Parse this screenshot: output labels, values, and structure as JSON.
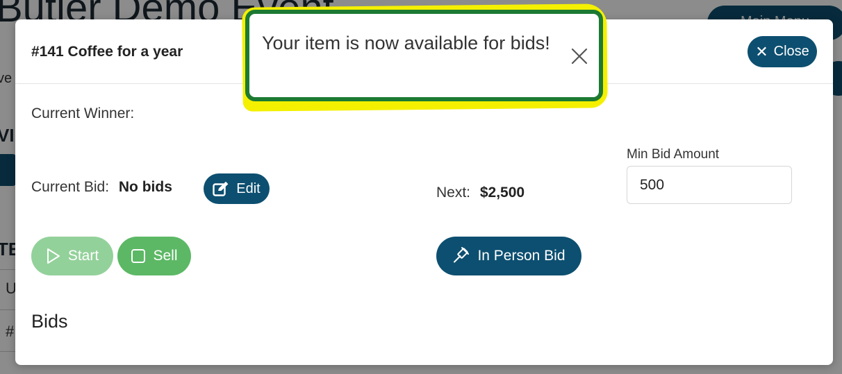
{
  "background": {
    "title": "Butler Demo Event",
    "menu_label": "Main Menu",
    "ev_fragment": "ve",
    "vid_fragment": "VID",
    "te_fragment": "TE",
    "u_fragment": "U",
    "hash_fragment": "#"
  },
  "modal": {
    "title": "#141 Coffee for a year",
    "close_label": "Close",
    "current_winner_label": "Current Winner:",
    "current_bid_label": "Current Bid:",
    "current_bid_value": "No bids",
    "edit_label": "Edit",
    "next_label": "Next:",
    "next_value": "$2,500",
    "min_bid_label": "Min Bid Amount",
    "min_bid_value": "500",
    "start_label": "Start",
    "sell_label": "Sell",
    "in_person_bid_label": "In Person Bid",
    "bids_heading": "Bids"
  },
  "toast": {
    "message": "Your item is now available for bids!"
  },
  "colors": {
    "primary": "#0d4f70",
    "success": "#5cb865",
    "success_disabled": "#93d19a",
    "toast_border": "#1c7a33",
    "highlight": "#f4f000"
  },
  "icons": {
    "close": "close-icon",
    "edit": "edit-icon",
    "start": "play-icon",
    "sell": "square-icon",
    "in_person_bid": "gavel-icon",
    "toast_close": "close-icon"
  }
}
